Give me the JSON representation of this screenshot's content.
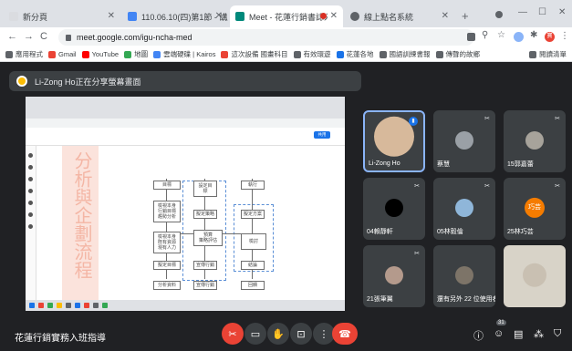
{
  "browser": {
    "tabs": [
      {
        "title": "新分頁",
        "icon": "new-tab-icon",
        "color": "#dadce0",
        "active": false
      },
      {
        "title": "110.06.10(四)第1節 - 講座行...",
        "icon": "doc-icon",
        "color": "#4285f4",
        "active": false
      },
      {
        "title": "Meet - 花蓮行銷書誌入匠旨",
        "icon": "meet-icon",
        "color": "#00897b",
        "active": true
      },
      {
        "title": "線上點名系統",
        "icon": "globe-icon",
        "color": "#5f6368",
        "active": false
      }
    ],
    "url": "meet.google.com/igu-ncha-med",
    "profile_initial": "寶",
    "bookmarks": [
      {
        "label": "應用程式",
        "color": "#5f6368"
      },
      {
        "label": "Gmail",
        "color": "#ea4335"
      },
      {
        "label": "YouTube",
        "color": "#ff0000"
      },
      {
        "label": "地圖",
        "color": "#34a853"
      },
      {
        "label": "雲端硬碟 | Kairos",
        "color": "#4285f4"
      },
      {
        "label": "這次設備 國畫科目",
        "color": "#ea4335"
      },
      {
        "label": "有效環遊",
        "color": "#5f6368"
      },
      {
        "label": "花蓮各地",
        "color": "#1a73e8"
      },
      {
        "label": "國語訓練書報",
        "color": "#5f6368"
      },
      {
        "label": "傳聲的故鄉",
        "color": "#5f6368"
      }
    ],
    "reading_list": "閱讀清單"
  },
  "meet": {
    "presenter_banner": "Li-Zong Ho正在分享螢幕畫面",
    "meeting_name": "花蓮行銷實務入班指導",
    "participant_count": "31",
    "tiles": [
      {
        "name": "Li-Zong Ho",
        "avatar_color": "#d7b99b",
        "initial": ""
      },
      {
        "name": "蔡慧",
        "avatar_color": "#9aa0a6",
        "initial": ""
      },
      {
        "name": "15郭嘉蕾",
        "avatar_color": "#a7a39b",
        "initial": ""
      },
      {
        "name": "04賴靜軒",
        "avatar_color": "#000000",
        "initial": ""
      },
      {
        "name": "05林毅倫",
        "avatar_color": "#8fb6d9",
        "initial": ""
      },
      {
        "name": "25林巧芸",
        "avatar_color": "#f57c00",
        "initial": "巧芸"
      },
      {
        "name": "21張筆翼",
        "avatar_color": "#b49a8c",
        "initial": ""
      },
      {
        "name": "還有另外 22 位使用者",
        "avatar_color": "#7d7468",
        "initial": ""
      },
      {
        "name": "",
        "avatar_color": "#c9c0b2",
        "initial": ""
      }
    ]
  },
  "shared_doc": {
    "vertical_title": "分析與企劃流程",
    "share_label": "共用",
    "boxes": [
      "目標",
      "檢視本身\n行銷目標\n趨勢分析",
      "檢視本身\n既有資源\n現有人力",
      "擬定目標",
      "分析資料",
      "設定目\n標",
      "擬定策略",
      "預算\n策略評估",
      "宣傳行銷",
      "宣傳行銷",
      "執行",
      "擬定方案",
      "檢討",
      "結論",
      "回饋"
    ]
  }
}
